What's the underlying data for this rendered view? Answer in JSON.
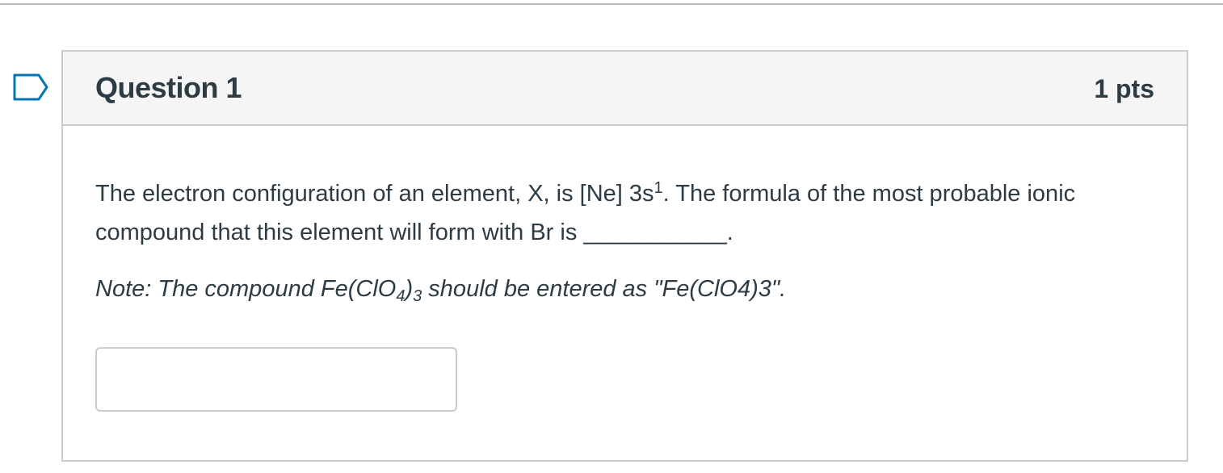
{
  "question": {
    "title": "Question 1",
    "points": "1 pts",
    "text_part1": "The electron configuration of an element, X, is [Ne] 3s",
    "text_superscript": "1",
    "text_part2": ". The formula of the most probable ionic compound that this element will form with Br is ___________.",
    "note_part1": "Note: The compound Fe(ClO",
    "note_subscript1": "4",
    "note_part2": ")",
    "note_subscript2": "3",
    "note_part3": " should be entered as \"Fe(ClO4)3\".",
    "answer_value": "",
    "answer_placeholder": ""
  },
  "icons": {
    "flag": "bookmark-flag-icon"
  },
  "colors": {
    "text": "#2d3b45",
    "header_bg": "#f5f5f5",
    "border": "#c7cdd1",
    "flag_stroke": "#0374b5"
  }
}
